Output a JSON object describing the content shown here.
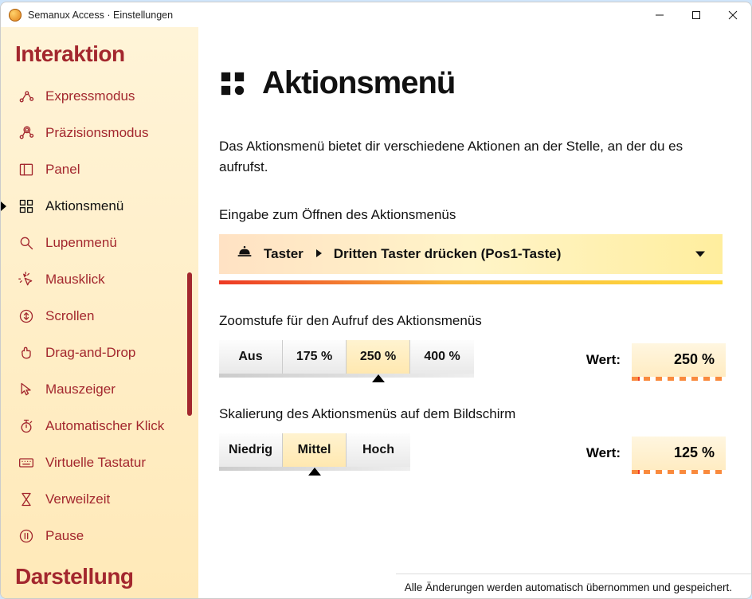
{
  "window_title": "Semanux Access · Einstellungen",
  "sidebar": {
    "heading1": "Interaktion",
    "heading2": "Darstellung",
    "items": [
      {
        "label": "Expressmodus",
        "icon": "nodes"
      },
      {
        "label": "Präzisionsmodus",
        "icon": "target"
      },
      {
        "label": "Panel",
        "icon": "panel"
      },
      {
        "label": "Aktionsmenü",
        "icon": "grid",
        "active": true
      },
      {
        "label": "Lupenmenü",
        "icon": "magnifier"
      },
      {
        "label": "Mausklick",
        "icon": "click"
      },
      {
        "label": "Scrollen",
        "icon": "scroll"
      },
      {
        "label": "Drag-and-Drop",
        "icon": "drag"
      },
      {
        "label": "Mauszeiger",
        "icon": "pointer"
      },
      {
        "label": "Automatischer Klick",
        "icon": "stopwatch"
      },
      {
        "label": "Virtuelle Tastatur",
        "icon": "keyboard"
      },
      {
        "label": "Verweilzeit",
        "icon": "hourglass"
      },
      {
        "label": "Pause",
        "icon": "pause"
      }
    ]
  },
  "page": {
    "title": "Aktionsmenü",
    "description": "Das Aktionsmenü bietet dir verschiedene Aktionen an der Stelle, an der du es aufrufst.",
    "input_label": "Eingabe zum Öffnen des Aktionsmenüs",
    "dropdown": {
      "category": "Taster",
      "value": "Dritten Taster drücken (Pos1-Taste)"
    },
    "zoom_label": "Zoomstufe für den Aufruf des Aktionsmenüs",
    "zoom_options": [
      "Aus",
      "175 %",
      "250 %",
      "400 %"
    ],
    "zoom_selected_index": 2,
    "zoom_value": "250 %",
    "scale_label": "Skalierung des Aktionsmenüs auf dem Bildschirm",
    "scale_options": [
      "Niedrig",
      "Mittel",
      "Hoch"
    ],
    "scale_selected_index": 1,
    "scale_value": "125 %",
    "wert_label": "Wert:"
  },
  "footer": "Alle Änderungen werden automatisch übernommen und gespeichert."
}
